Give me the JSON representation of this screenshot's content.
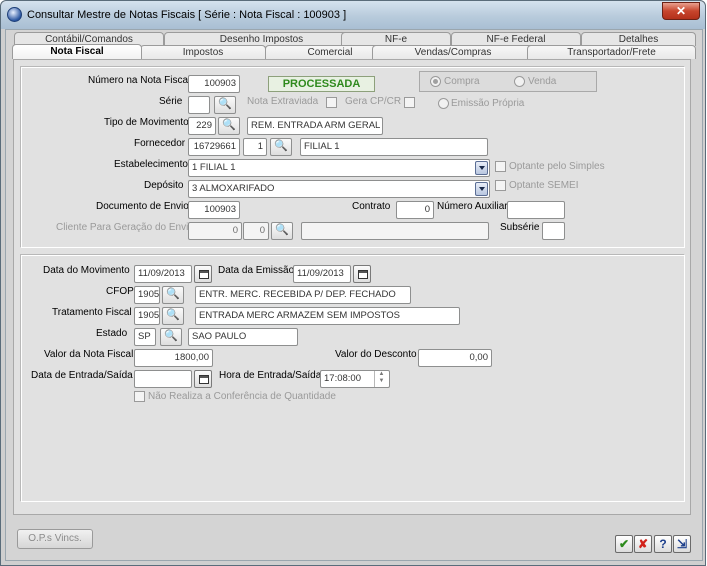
{
  "window": {
    "title": "Consultar Mestre de Notas Fiscais [ Série :    Nota Fiscal : 100903 ]",
    "close_glyph": "✕"
  },
  "tabs": {
    "back_row": [
      "Contábil/Comandos",
      "Desenho Impostos",
      "NF-e",
      "NF-e Federal",
      "Detalhes"
    ],
    "front_row": [
      "Nota Fiscal",
      "Impostos",
      "Comercial",
      "Vendas/Compras",
      "Transportador/Frete"
    ],
    "active": "Nota Fiscal"
  },
  "form": {
    "numero_label": "Número na Nota Fiscal",
    "numero_value": "100903",
    "status": "PROCESSADA",
    "serie_label": "Série",
    "serie_value": "",
    "nota_extraviada_label": "Nota Extraviada",
    "gera_cpcr_label": "Gera CP/CR",
    "compra_label": "Compra",
    "venda_label": "Venda",
    "emissao_propria_label": "Emissão Própria",
    "tipo_label": "Tipo de Movimento",
    "tipo_code": "229",
    "tipo_desc": "REM. ENTRADA ARM GERAL NF",
    "fornecedor_label": "Fornecedor",
    "fornecedor_code": "16729661",
    "fornecedor_seq": "1",
    "fornecedor_name": "FILIAL 1",
    "estabelecimento_label": "Estabelecimento",
    "estabelecimento_value": "1 FILIAL 1",
    "optante_simples_label": "Optante pelo Simples",
    "deposito_label": "Depósito",
    "deposito_value": "3 ALMOXARIFADO",
    "optante_semei_label": "Optante SEMEI",
    "doc_envio_label": "Documento de Envio",
    "doc_envio_value": "100903",
    "contrato_label": "Contrato",
    "contrato_value": "0",
    "numero_auxiliar_label": "Número Auxiliar",
    "numero_auxiliar_value": "",
    "cliente_label": "Cliente Para Geração do Envio",
    "cliente_code": "0",
    "cliente_seq": "0",
    "cliente_name": "",
    "subserie_label": "Subsérie",
    "subserie_value": "",
    "data_mov_label": "Data do Movimento",
    "data_mov_value": "11/09/2013",
    "data_emissao_label": "Data da Emissão",
    "data_emissao_value": "11/09/2013",
    "cfop_label": "CFOP",
    "cfop_code": "1905",
    "cfop_desc": "ENTR. MERC. RECEBIDA P/ DEP. FECHADO",
    "tratamento_label": "Tratamento Fiscal",
    "tratamento_code": "1905",
    "tratamento_desc": "ENTRADA MERC ARMAZEM SEM IMPOSTOS",
    "estado_label": "Estado",
    "estado_code": "SP",
    "estado_name": "SAO PAULO",
    "valor_nf_label": "Valor da Nota Fiscal",
    "valor_nf_value": "1800,00",
    "valor_desc_label": "Valor do Desconto",
    "valor_desc_value": "0,00",
    "data_es_label": "Data de Entrada/Saída",
    "data_es_value": "",
    "hora_es_label": "Hora de Entrada/Saída",
    "hora_es_value": "17:08:00",
    "nao_realiza_label": "Não Realiza a Conferência de Quantidade"
  },
  "footer": {
    "ops_button": "O.P.s Vincs.",
    "ok_glyph": "✔",
    "cancel_glyph": "✘",
    "help_glyph": "?",
    "exit_glyph": "⇲"
  }
}
